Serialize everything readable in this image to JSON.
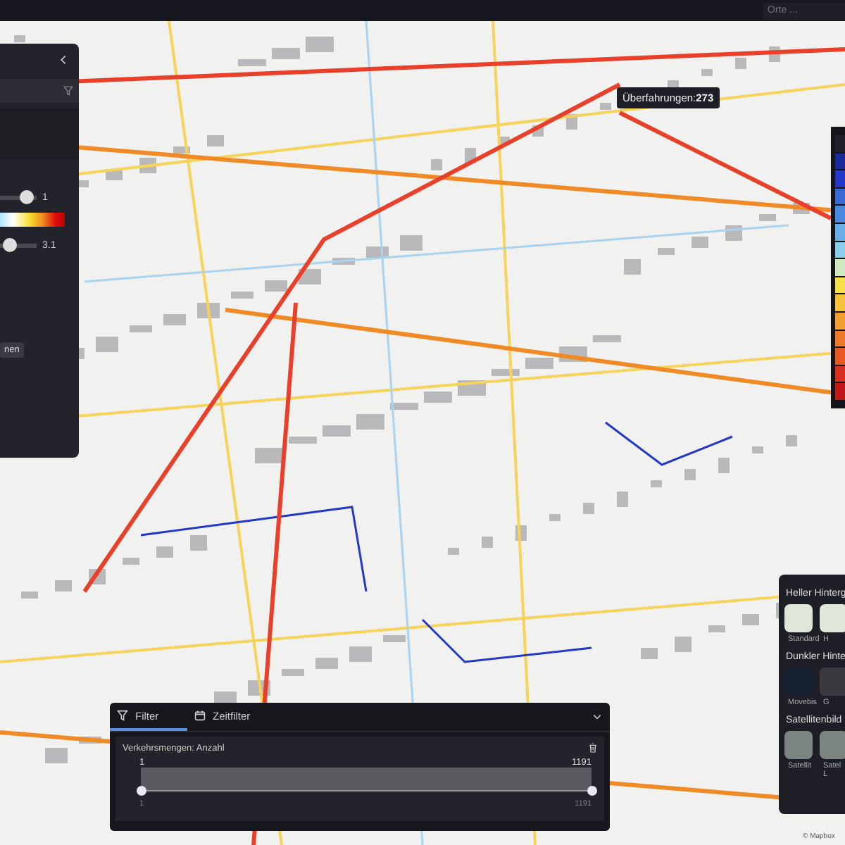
{
  "top_bar": {
    "search": {
      "placeholder": "Orte ..."
    }
  },
  "tooltip": {
    "text": "Überfahrungen:**273**"
  },
  "left_panel": {
    "sliders": [
      {
        "level": 0.9,
        "reading": "1"
      },
      {
        "level": 0.15,
        "reading": "3.1"
      }
    ],
    "button": "nen"
  },
  "background_panel": {
    "sections": [
      {
        "title": "Heller Hinterg",
        "tiles": [
          {
            "label": "Standard",
            "kind": "light"
          },
          {
            "label": "H",
            "kind": "light"
          }
        ]
      },
      {
        "title": "Dunkler Hinte",
        "tiles": [
          {
            "label": "Movebis",
            "kind": "dark"
          },
          {
            "label": "G",
            "kind": "grey"
          }
        ]
      },
      {
        "title": "Satellitenbild",
        "tiles": [
          {
            "label": "Satellit",
            "kind": "satellite"
          },
          {
            "label": "Satel L",
            "kind": "satellite"
          }
        ]
      }
    ]
  },
  "filter_panel": {
    "tabs": [
      {
        "label": "Filter",
        "selected": true
      },
      {
        "label": "Zeitfilter",
        "selected": false
      }
    ],
    "filter": {
      "title": "Verkehrsmengen: Anzahl",
      "min": "1",
      "max": "1191",
      "thumbs": [
        {
          "level": 0
        },
        {
          "level": 1
        }
      ],
      "min_label": "1",
      "max_label": "1191"
    }
  },
  "attribution": "© Mapbox"
}
